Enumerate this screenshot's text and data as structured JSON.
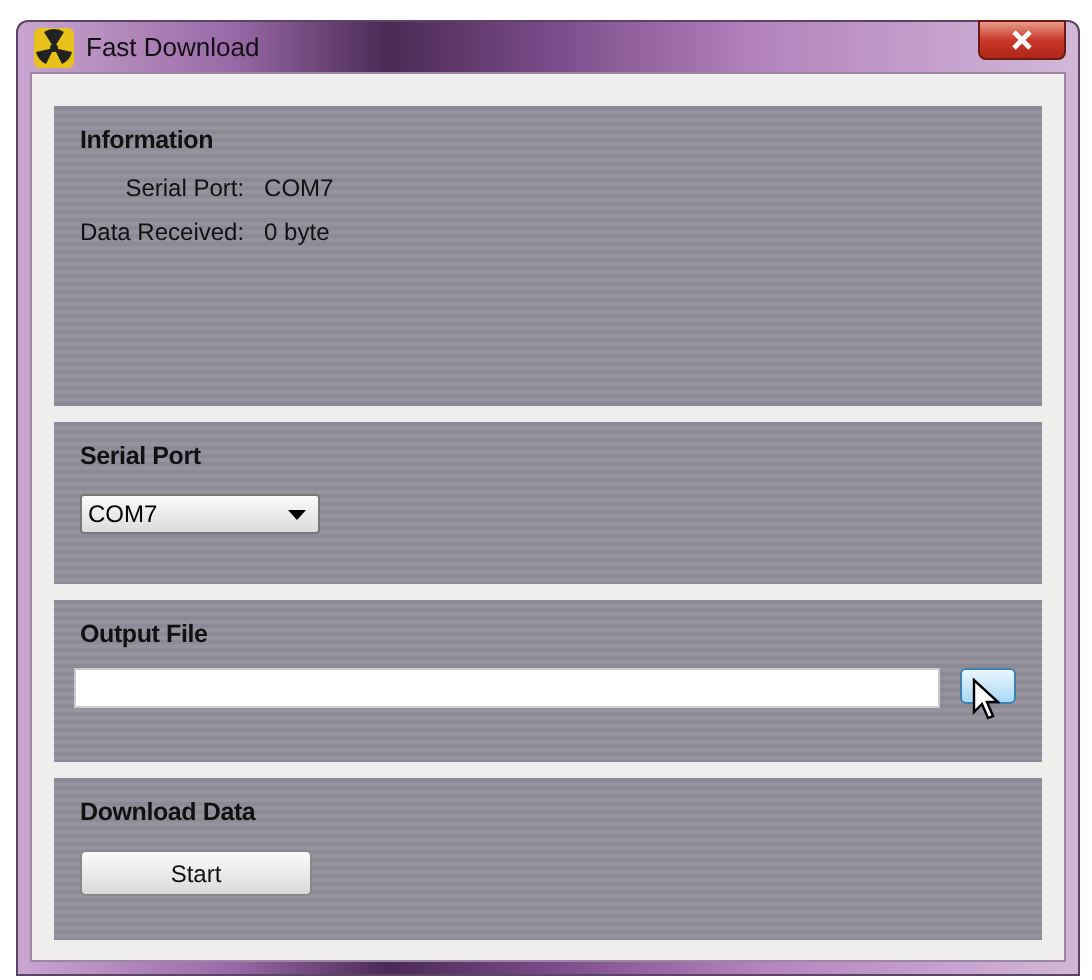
{
  "window": {
    "title": "Fast Download"
  },
  "information": {
    "heading": "Information",
    "rows": [
      {
        "label": "Serial Port:",
        "value": "COM7"
      },
      {
        "label": "Data Received:",
        "value": "0 byte"
      }
    ]
  },
  "serial_port": {
    "heading": "Serial Port",
    "dropdown": {
      "value": "COM7"
    }
  },
  "output_file": {
    "heading": "Output File"
  },
  "download_data": {
    "heading": "Download Data",
    "button": "Start"
  }
}
